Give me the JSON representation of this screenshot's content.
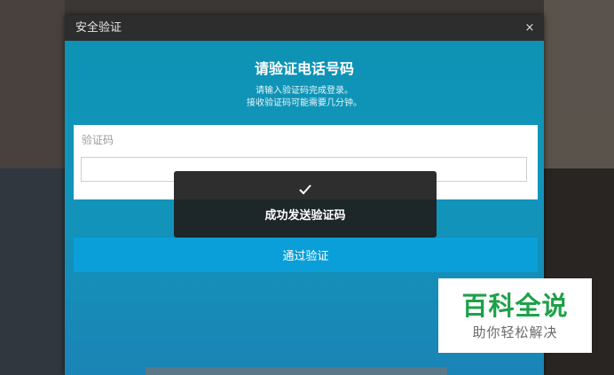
{
  "dialog": {
    "title": "安全验证",
    "close_label": "×",
    "heading": "请验证电话号码",
    "sub_line1": "请输入验证码完成登录。",
    "sub_line2": "接收验证码可能需要几分钟。",
    "code_label": "验证码",
    "code_value": "",
    "code_placeholder": "",
    "verify_button": "通过验证"
  },
  "toast": {
    "icon": "check-icon",
    "message": "成功发送验证码"
  },
  "watermark": {
    "title": "百科全说",
    "subtitle": "助你轻松解决"
  },
  "colors": {
    "dialog_bg": "#1294ba",
    "titlebar_bg": "#2d2d2d",
    "button_bg": "#0a9fd9",
    "toast_bg": "#1e1e1e",
    "watermark_green": "#1ea14a"
  }
}
